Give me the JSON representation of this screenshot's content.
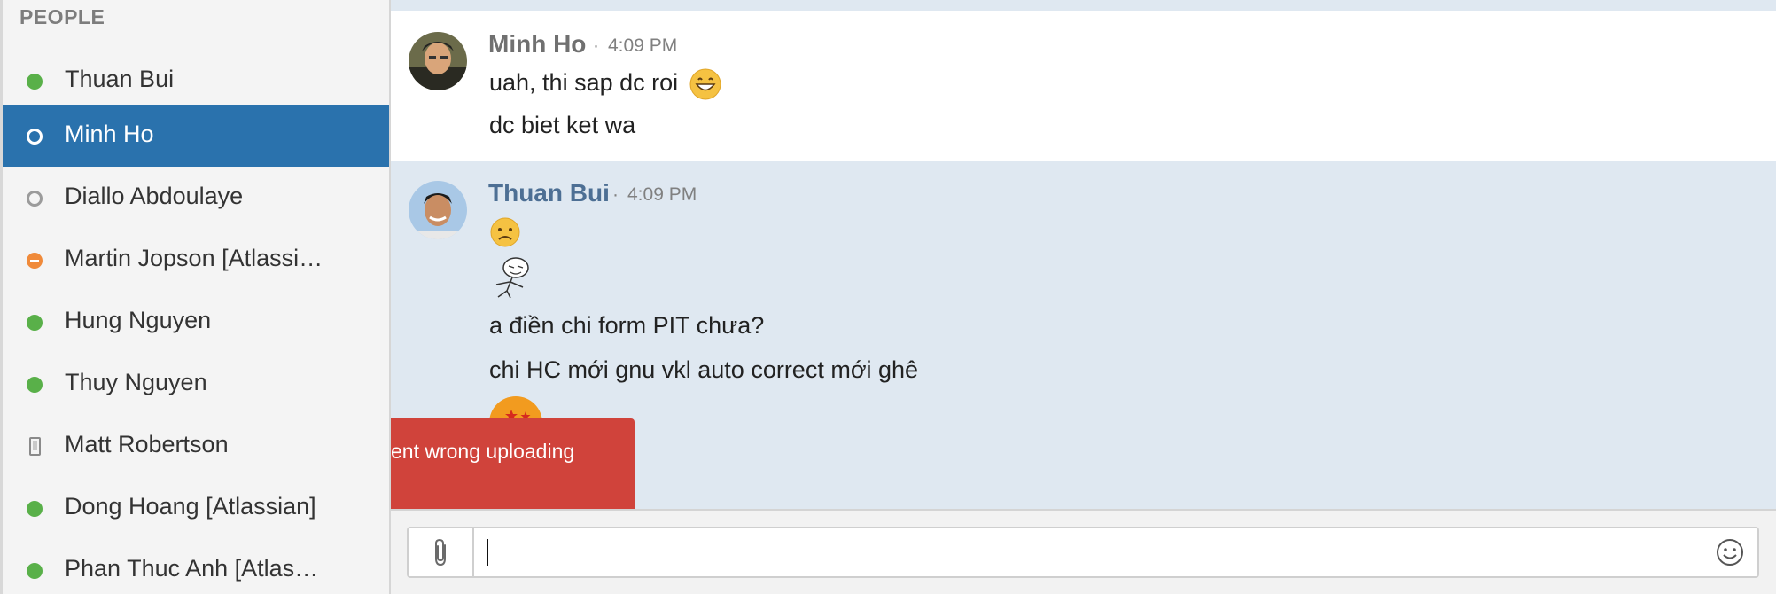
{
  "sidebar": {
    "section_title": "PEOPLE",
    "people": [
      {
        "name": "Thuan Bui",
        "status": "online",
        "active": false
      },
      {
        "name": "Minh Ho",
        "status": "online",
        "active": true
      },
      {
        "name": "Diallo Abdoulaye",
        "status": "offline",
        "active": false
      },
      {
        "name": "Martin Jopson [Atlassi…",
        "status": "dnd",
        "active": false
      },
      {
        "name": "Hung Nguyen",
        "status": "online",
        "active": false
      },
      {
        "name": "Thuy Nguyen",
        "status": "online",
        "active": false
      },
      {
        "name": "Matt Robertson",
        "status": "mobile",
        "active": false
      },
      {
        "name": "Dong Hoang [Atlassian]",
        "status": "online",
        "active": false
      },
      {
        "name": "Phan Thuc Anh [Atlas…",
        "status": "online",
        "active": false
      }
    ]
  },
  "chat": {
    "groups": [
      {
        "sender": "Minh Ho",
        "time": "4:09 PM",
        "separator": "·",
        "lines": [
          "uah, thi sap dc roi",
          "dc biet ket wa"
        ]
      },
      {
        "sender": "Thuan Bui",
        "time": "4:09 PM",
        "separator": "·",
        "lines": [
          "a điền chi form PIT chưa?",
          "chi HC mới gnu vkl auto correct mới ghê"
        ]
      }
    ]
  },
  "tooltip": {
    "text": "ent wrong uploading"
  },
  "composer": {
    "value": "",
    "attach_icon": "paperclip-icon",
    "emoji_icon": "smiley-icon"
  },
  "colors": {
    "accent": "#2a72ad",
    "online": "#59b049",
    "dnd": "#f08a3a",
    "error": "#d0433b",
    "chat_bg": "#dfe8f1"
  }
}
